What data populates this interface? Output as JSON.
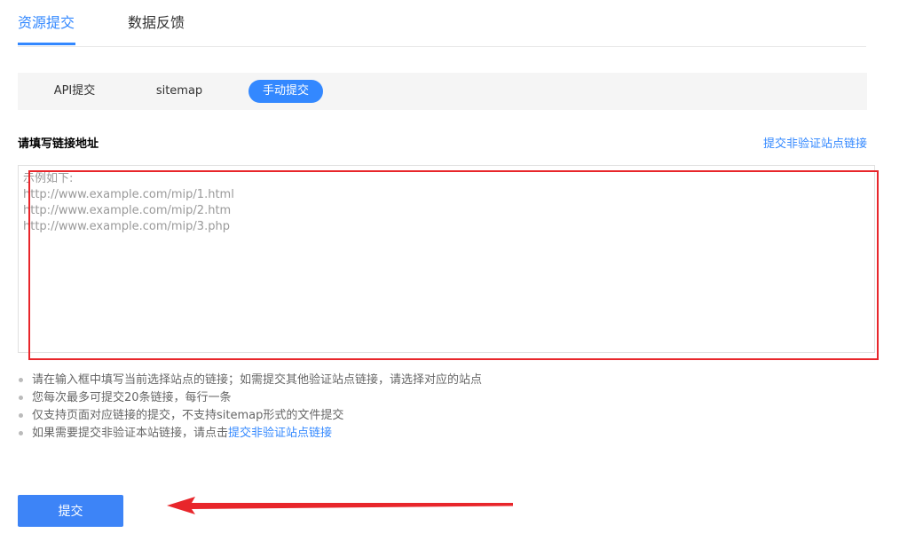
{
  "tabs": [
    {
      "label": "资源提交",
      "active": true
    },
    {
      "label": "数据反馈",
      "active": false
    }
  ],
  "subtabs": [
    {
      "label": "API提交",
      "active": false
    },
    {
      "label": "sitemap",
      "active": false
    },
    {
      "label": "手动提交",
      "active": true
    }
  ],
  "form": {
    "label": "请填写链接地址",
    "unverified_link": "提交非验证站点链接",
    "placeholder": "示例如下:\nhttp://www.example.com/mip/1.html\nhttp://www.example.com/mip/2.htm\nhttp://www.example.com/mip/3.php",
    "value": ""
  },
  "notes": {
    "items": [
      "请在输入框中填写当前选择站点的链接；如需提交其他验证站点链接，请选择对应的站点",
      "您每次最多可提交20条链接，每行一条",
      "仅支持页面对应链接的提交，不支持sitemap形式的文件提交"
    ],
    "last_prefix": "如果需要提交非验证本站链接，请点击",
    "last_link": "提交非验证站点链接"
  },
  "submit_label": "提交",
  "colors": {
    "accent": "#3388ff",
    "annotation_red": "#e8262b"
  }
}
